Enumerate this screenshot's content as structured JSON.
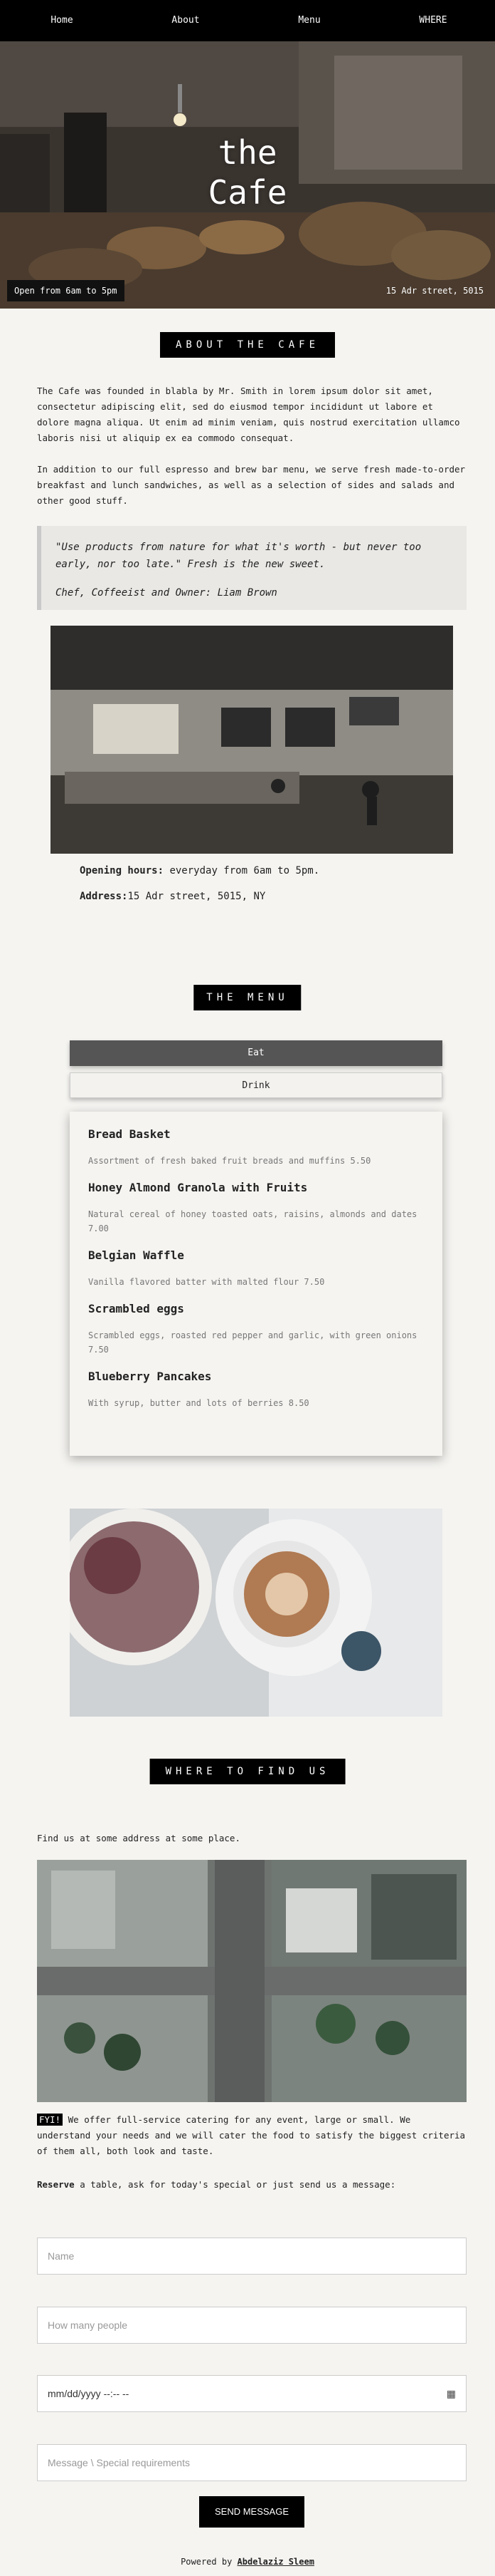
{
  "nav": {
    "items": [
      "Home",
      "About",
      "Menu",
      "WHERE"
    ]
  },
  "hero": {
    "title_line1": "the",
    "title_line2": "Cafe",
    "hours_badge": "Open from 6am to 5pm",
    "address_badge": "15 Adr street, 5015"
  },
  "about": {
    "heading": "ABOUT THE CAFE",
    "para1": "The Cafe was founded in blabla by Mr. Smith in lorem ipsum dolor sit amet, consectetur adipiscing elit, sed do eiusmod tempor incididunt ut labore et dolore magna aliqua. Ut enim ad minim veniam, quis nostrud exercitation ullamco laboris nisi ut aliquip ex ea commodo consequat.",
    "para2": "In addition to our full espresso and brew bar menu, we serve fresh made-to-order breakfast and lunch sandwiches, as well as a selection of sides and salads and other good stuff.",
    "quote": "\"Use products from nature for what it's worth - but never too early, nor too late.\" Fresh is the new sweet.",
    "quote_author": "Chef, Coffeeist and Owner: Liam Brown",
    "hours_label": "Opening hours:",
    "hours_value": " everyday from 6am to 5pm.",
    "address_label": "Address:",
    "address_value": "15 Adr street, 5015, NY"
  },
  "menu": {
    "heading": "THE MENU",
    "tabs": [
      "Eat",
      "Drink"
    ],
    "items": [
      {
        "name": "Bread Basket",
        "desc": "Assortment of fresh baked fruit breads and muffins 5.50"
      },
      {
        "name": "Honey Almond Granola with Fruits",
        "desc": "Natural cereal of honey toasted oats, raisins, almonds and dates 7.00"
      },
      {
        "name": "Belgian Waffle",
        "desc": "Vanilla flavored batter with malted flour 7.50"
      },
      {
        "name": "Scrambled eggs",
        "desc": "Scrambled eggs, roasted red pepper and garlic, with green onions 7.50"
      },
      {
        "name": "Blueberry Pancakes",
        "desc": "With syrup, butter and lots of berries 8.50"
      }
    ]
  },
  "where": {
    "heading": "WHERE TO FIND US",
    "intro": "Find us at some address at some place.",
    "fyi_tag": "FYI!",
    "fyi_text": " We offer full-service catering for any event, large or small. We understand your needs and we will cater the food to satisfy the biggest criteria of them all, both look and taste.",
    "reserve_bold": "Reserve",
    "reserve_text": " a table, ask for today's special or just send us a message:"
  },
  "form": {
    "name_placeholder": "Name",
    "people_placeholder": "How many people",
    "date_placeholder": "mm/dd/yyyy --:-- --",
    "message_placeholder": "Message \\ Special requirements",
    "submit_label": "SEND MESSAGE"
  },
  "footer": {
    "prefix": "Powered by ",
    "author": "Abdelaziz Sleem"
  }
}
